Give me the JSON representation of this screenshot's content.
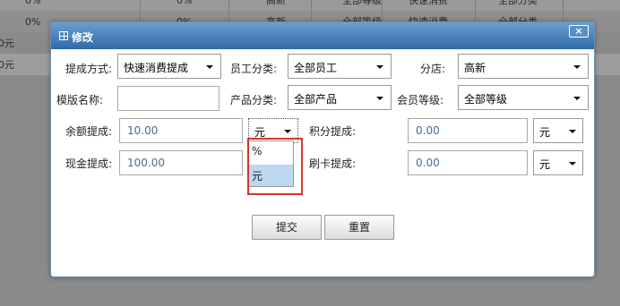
{
  "background": {
    "rows": [
      {
        "c1": "0%",
        "c2": "0%",
        "c3": "高新",
        "c4": "全部等级",
        "c5": "快速消费",
        "c6": "全部分类"
      },
      {
        "c1": "0%",
        "c2": "0%",
        "c3": "高新",
        "c4": "全部等级",
        "c5": "快速消费",
        "c6": "全部分类"
      },
      {
        "c1": "0元",
        "c2": "",
        "c3": "",
        "c4": "",
        "c5": "",
        "c6": ""
      },
      {
        "c1": "0元",
        "c2": "",
        "c3": "",
        "c4": "",
        "c5": "",
        "c6": ""
      }
    ]
  },
  "modal": {
    "title": "修改",
    "close": "×",
    "fields": {
      "commission_method": {
        "label": "提成方式:",
        "value": "快速消费提成"
      },
      "employee_category": {
        "label": "员工分类:",
        "value": "全部员工"
      },
      "branch": {
        "label": "分店:",
        "value": "高新"
      },
      "template_name": {
        "label": "模版名称:",
        "value": ""
      },
      "product_category": {
        "label": "产品分类:",
        "value": "全部产品"
      },
      "member_level": {
        "label": "会员等级:",
        "value": "全部等级"
      },
      "balance_commission": {
        "label": "余额提成:",
        "value": "10.00",
        "unit": "元"
      },
      "points_commission": {
        "label": "积分提成:",
        "value": "0.00",
        "unit": "元"
      },
      "cash_commission": {
        "label": "现金提成:",
        "value": "100.00"
      },
      "card_commission": {
        "label": "刷卡提成:",
        "value": "0.00",
        "unit": "元"
      }
    },
    "unit_dropdown": {
      "options": [
        "%",
        "元"
      ],
      "selected": "元"
    },
    "buttons": {
      "submit": "提交",
      "reset": "重置"
    }
  },
  "colors": {
    "header": "#2f6aa8",
    "highlight": "#d9342b",
    "selected_option": "#bcd8f0"
  }
}
